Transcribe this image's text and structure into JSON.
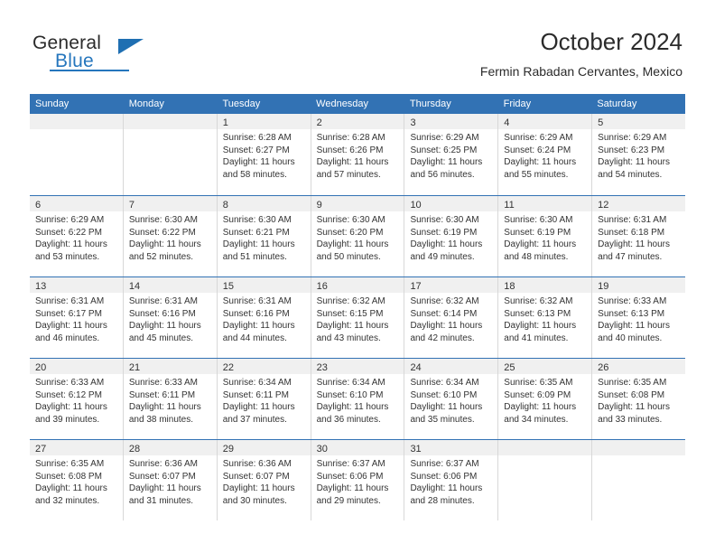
{
  "brand": {
    "name_part1": "General",
    "name_part2": "Blue"
  },
  "header": {
    "title": "October 2024",
    "subtitle": "Fermin Rabadan Cervantes, Mexico"
  },
  "calendar": {
    "weekdays": [
      "Sunday",
      "Monday",
      "Tuesday",
      "Wednesday",
      "Thursday",
      "Friday",
      "Saturday"
    ],
    "colors": {
      "header_blue": "#3272b4",
      "daynum_band": "#f0f0f0",
      "brand_blue": "#2576bd",
      "text": "#333333"
    },
    "weeks": [
      [
        {
          "day": ""
        },
        {
          "day": ""
        },
        {
          "day": "1",
          "sunrise": "Sunrise: 6:28 AM",
          "sunset": "Sunset: 6:27 PM",
          "daylight1": "Daylight: 11 hours",
          "daylight2": "and 58 minutes."
        },
        {
          "day": "2",
          "sunrise": "Sunrise: 6:28 AM",
          "sunset": "Sunset: 6:26 PM",
          "daylight1": "Daylight: 11 hours",
          "daylight2": "and 57 minutes."
        },
        {
          "day": "3",
          "sunrise": "Sunrise: 6:29 AM",
          "sunset": "Sunset: 6:25 PM",
          "daylight1": "Daylight: 11 hours",
          "daylight2": "and 56 minutes."
        },
        {
          "day": "4",
          "sunrise": "Sunrise: 6:29 AM",
          "sunset": "Sunset: 6:24 PM",
          "daylight1": "Daylight: 11 hours",
          "daylight2": "and 55 minutes."
        },
        {
          "day": "5",
          "sunrise": "Sunrise: 6:29 AM",
          "sunset": "Sunset: 6:23 PM",
          "daylight1": "Daylight: 11 hours",
          "daylight2": "and 54 minutes."
        }
      ],
      [
        {
          "day": "6",
          "sunrise": "Sunrise: 6:29 AM",
          "sunset": "Sunset: 6:22 PM",
          "daylight1": "Daylight: 11 hours",
          "daylight2": "and 53 minutes."
        },
        {
          "day": "7",
          "sunrise": "Sunrise: 6:30 AM",
          "sunset": "Sunset: 6:22 PM",
          "daylight1": "Daylight: 11 hours",
          "daylight2": "and 52 minutes."
        },
        {
          "day": "8",
          "sunrise": "Sunrise: 6:30 AM",
          "sunset": "Sunset: 6:21 PM",
          "daylight1": "Daylight: 11 hours",
          "daylight2": "and 51 minutes."
        },
        {
          "day": "9",
          "sunrise": "Sunrise: 6:30 AM",
          "sunset": "Sunset: 6:20 PM",
          "daylight1": "Daylight: 11 hours",
          "daylight2": "and 50 minutes."
        },
        {
          "day": "10",
          "sunrise": "Sunrise: 6:30 AM",
          "sunset": "Sunset: 6:19 PM",
          "daylight1": "Daylight: 11 hours",
          "daylight2": "and 49 minutes."
        },
        {
          "day": "11",
          "sunrise": "Sunrise: 6:30 AM",
          "sunset": "Sunset: 6:19 PM",
          "daylight1": "Daylight: 11 hours",
          "daylight2": "and 48 minutes."
        },
        {
          "day": "12",
          "sunrise": "Sunrise: 6:31 AM",
          "sunset": "Sunset: 6:18 PM",
          "daylight1": "Daylight: 11 hours",
          "daylight2": "and 47 minutes."
        }
      ],
      [
        {
          "day": "13",
          "sunrise": "Sunrise: 6:31 AM",
          "sunset": "Sunset: 6:17 PM",
          "daylight1": "Daylight: 11 hours",
          "daylight2": "and 46 minutes."
        },
        {
          "day": "14",
          "sunrise": "Sunrise: 6:31 AM",
          "sunset": "Sunset: 6:16 PM",
          "daylight1": "Daylight: 11 hours",
          "daylight2": "and 45 minutes."
        },
        {
          "day": "15",
          "sunrise": "Sunrise: 6:31 AM",
          "sunset": "Sunset: 6:16 PM",
          "daylight1": "Daylight: 11 hours",
          "daylight2": "and 44 minutes."
        },
        {
          "day": "16",
          "sunrise": "Sunrise: 6:32 AM",
          "sunset": "Sunset: 6:15 PM",
          "daylight1": "Daylight: 11 hours",
          "daylight2": "and 43 minutes."
        },
        {
          "day": "17",
          "sunrise": "Sunrise: 6:32 AM",
          "sunset": "Sunset: 6:14 PM",
          "daylight1": "Daylight: 11 hours",
          "daylight2": "and 42 minutes."
        },
        {
          "day": "18",
          "sunrise": "Sunrise: 6:32 AM",
          "sunset": "Sunset: 6:13 PM",
          "daylight1": "Daylight: 11 hours",
          "daylight2": "and 41 minutes."
        },
        {
          "day": "19",
          "sunrise": "Sunrise: 6:33 AM",
          "sunset": "Sunset: 6:13 PM",
          "daylight1": "Daylight: 11 hours",
          "daylight2": "and 40 minutes."
        }
      ],
      [
        {
          "day": "20",
          "sunrise": "Sunrise: 6:33 AM",
          "sunset": "Sunset: 6:12 PM",
          "daylight1": "Daylight: 11 hours",
          "daylight2": "and 39 minutes."
        },
        {
          "day": "21",
          "sunrise": "Sunrise: 6:33 AM",
          "sunset": "Sunset: 6:11 PM",
          "daylight1": "Daylight: 11 hours",
          "daylight2": "and 38 minutes."
        },
        {
          "day": "22",
          "sunrise": "Sunrise: 6:34 AM",
          "sunset": "Sunset: 6:11 PM",
          "daylight1": "Daylight: 11 hours",
          "daylight2": "and 37 minutes."
        },
        {
          "day": "23",
          "sunrise": "Sunrise: 6:34 AM",
          "sunset": "Sunset: 6:10 PM",
          "daylight1": "Daylight: 11 hours",
          "daylight2": "and 36 minutes."
        },
        {
          "day": "24",
          "sunrise": "Sunrise: 6:34 AM",
          "sunset": "Sunset: 6:10 PM",
          "daylight1": "Daylight: 11 hours",
          "daylight2": "and 35 minutes."
        },
        {
          "day": "25",
          "sunrise": "Sunrise: 6:35 AM",
          "sunset": "Sunset: 6:09 PM",
          "daylight1": "Daylight: 11 hours",
          "daylight2": "and 34 minutes."
        },
        {
          "day": "26",
          "sunrise": "Sunrise: 6:35 AM",
          "sunset": "Sunset: 6:08 PM",
          "daylight1": "Daylight: 11 hours",
          "daylight2": "and 33 minutes."
        }
      ],
      [
        {
          "day": "27",
          "sunrise": "Sunrise: 6:35 AM",
          "sunset": "Sunset: 6:08 PM",
          "daylight1": "Daylight: 11 hours",
          "daylight2": "and 32 minutes."
        },
        {
          "day": "28",
          "sunrise": "Sunrise: 6:36 AM",
          "sunset": "Sunset: 6:07 PM",
          "daylight1": "Daylight: 11 hours",
          "daylight2": "and 31 minutes."
        },
        {
          "day": "29",
          "sunrise": "Sunrise: 6:36 AM",
          "sunset": "Sunset: 6:07 PM",
          "daylight1": "Daylight: 11 hours",
          "daylight2": "and 30 minutes."
        },
        {
          "day": "30",
          "sunrise": "Sunrise: 6:37 AM",
          "sunset": "Sunset: 6:06 PM",
          "daylight1": "Daylight: 11 hours",
          "daylight2": "and 29 minutes."
        },
        {
          "day": "31",
          "sunrise": "Sunrise: 6:37 AM",
          "sunset": "Sunset: 6:06 PM",
          "daylight1": "Daylight: 11 hours",
          "daylight2": "and 28 minutes."
        },
        {
          "day": ""
        },
        {
          "day": ""
        }
      ]
    ]
  }
}
